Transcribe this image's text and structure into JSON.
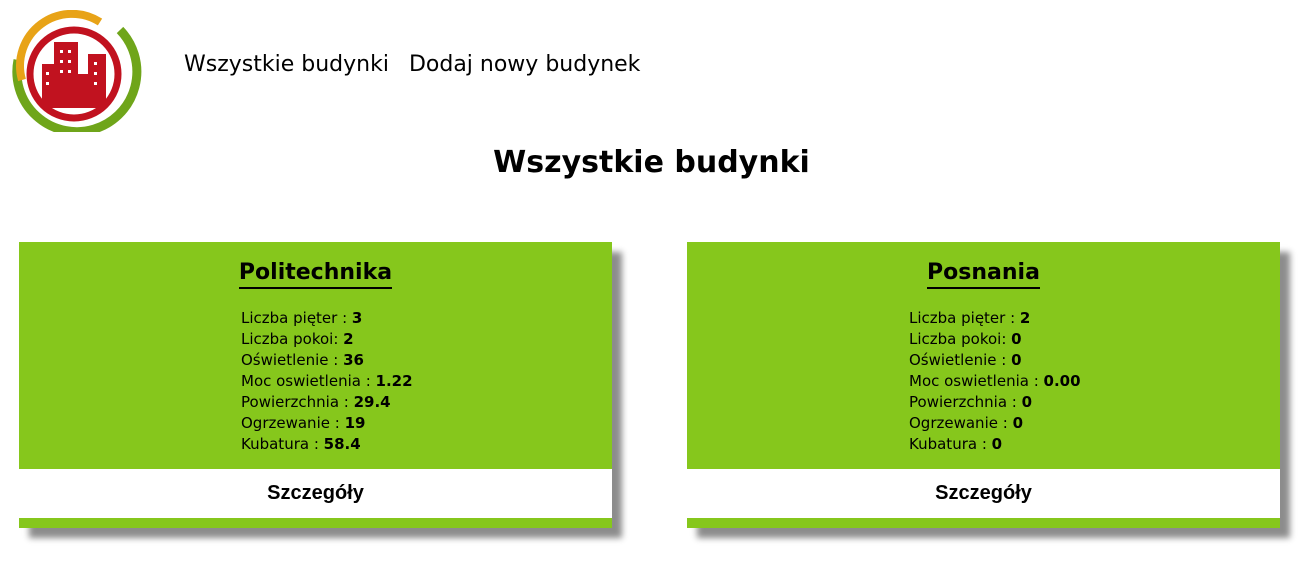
{
  "nav": {
    "all_buildings": "Wszystkie budynki",
    "add_building": "Dodaj nowy budynek"
  },
  "page": {
    "title": "Wszystkie budynki"
  },
  "colors": {
    "card_bg": "#86c71c",
    "logo_red": "#c1121f",
    "logo_orange": "#e8a317",
    "logo_green": "#6fa51a"
  },
  "buildings": [
    {
      "name": "Politechnika",
      "props": [
        {
          "label": "Liczba pięter : ",
          "value": "3"
        },
        {
          "label": "Liczba pokoi: ",
          "value": "2"
        },
        {
          "label": "Oświetlenie : ",
          "value": "36"
        },
        {
          "label": "Moc oswietlenia : ",
          "value": "1.22"
        },
        {
          "label": "Powierzchnia : ",
          "value": "29.4"
        },
        {
          "label": "Ogrzewanie : ",
          "value": "19"
        },
        {
          "label": "Kubatura : ",
          "value": "58.4"
        }
      ],
      "details_label": "Szczegóły"
    },
    {
      "name": "Posnania",
      "props": [
        {
          "label": "Liczba pięter : ",
          "value": "2"
        },
        {
          "label": "Liczba pokoi: ",
          "value": "0"
        },
        {
          "label": "Oświetlenie : ",
          "value": "0"
        },
        {
          "label": "Moc oswietlenia : ",
          "value": "0.00"
        },
        {
          "label": "Powierzchnia : ",
          "value": "0"
        },
        {
          "label": "Ogrzewanie : ",
          "value": "0"
        },
        {
          "label": "Kubatura : ",
          "value": "0"
        }
      ],
      "details_label": "Szczegóły"
    }
  ]
}
